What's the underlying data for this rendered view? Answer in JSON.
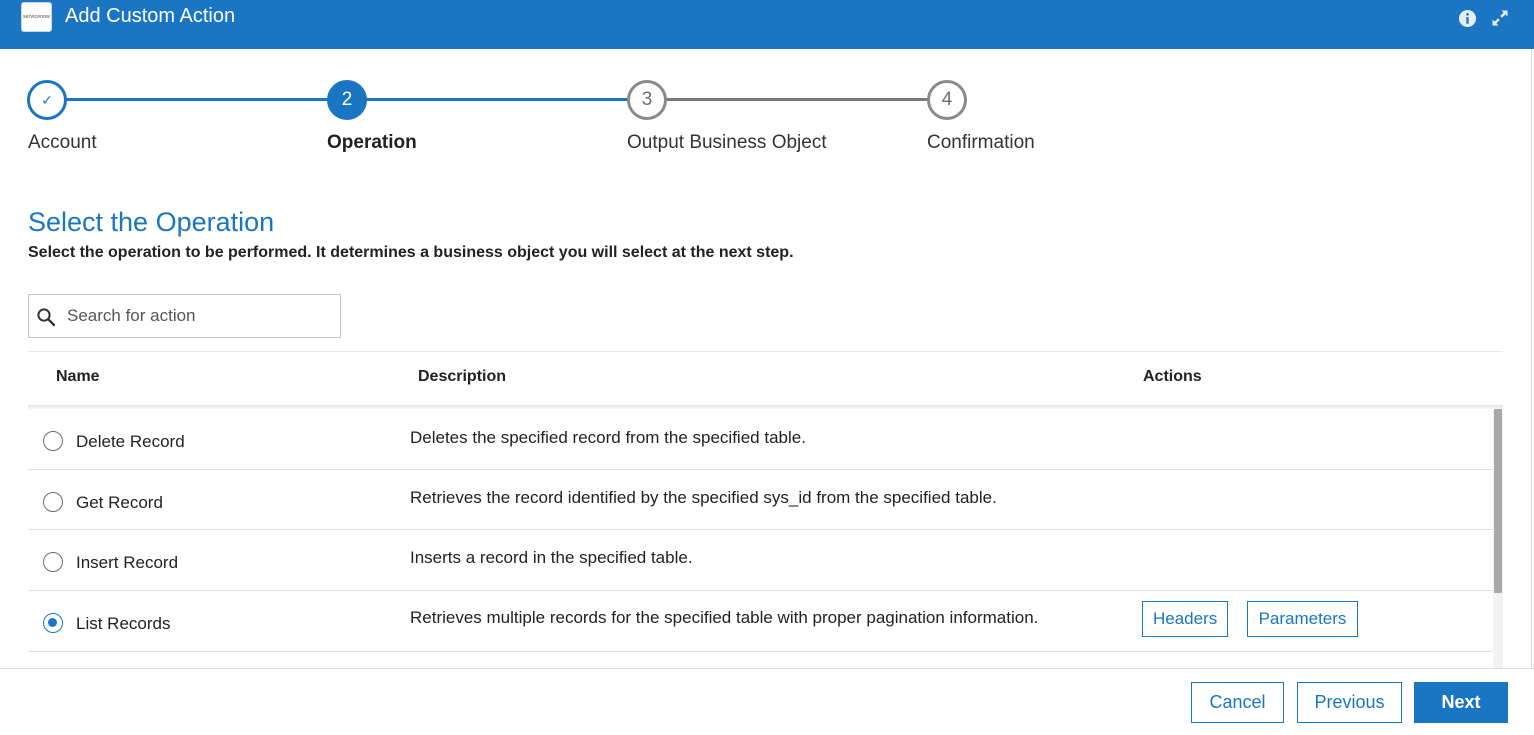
{
  "header": {
    "logo_text": "servicenow",
    "title": "Add Custom Action",
    "info_icon": "info-icon",
    "expand_icon": "expand-icon"
  },
  "stepper": {
    "steps": [
      {
        "number": "✓",
        "label": "Account",
        "state": "completed"
      },
      {
        "number": "2",
        "label": "Operation",
        "state": "active"
      },
      {
        "number": "3",
        "label": "Output Business Object",
        "state": "pending"
      },
      {
        "number": "4",
        "label": "Confirmation",
        "state": "pending"
      }
    ]
  },
  "content": {
    "title": "Select the Operation",
    "description": "Select the operation to be performed. It determines a business object you will select at the next step.",
    "search_placeholder": "Search for action"
  },
  "table": {
    "columns": [
      "Name",
      "Description",
      "Actions"
    ],
    "rows": [
      {
        "name": "Delete Record",
        "description": "Deletes the specified record from the specified table.",
        "selected": false
      },
      {
        "name": "Get Record",
        "description": "Retrieves the record identified by the specified sys_id from the specified table.",
        "selected": false
      },
      {
        "name": "Insert Record",
        "description": "Inserts a record in the specified table.",
        "selected": false
      },
      {
        "name": "List Records",
        "description": "Retrieves multiple records for the specified table with proper pagination information.",
        "selected": true,
        "actions": [
          "Headers",
          "Parameters"
        ]
      }
    ]
  },
  "footer": {
    "cancel_label": "Cancel",
    "previous_label": "Previous",
    "next_label": "Next"
  },
  "colors": {
    "accent": "#1a76c3",
    "pending": "#8a8a8a"
  }
}
